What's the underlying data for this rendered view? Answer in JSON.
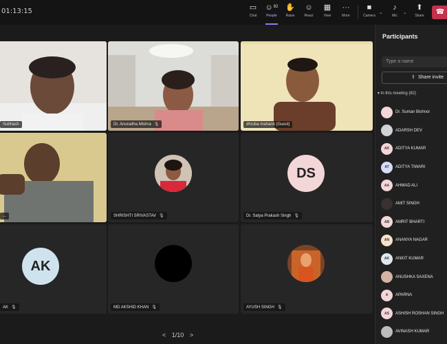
{
  "timer": "01:13:15",
  "toolbar": {
    "chat": {
      "label": "Chat",
      "icon": "chat-icon"
    },
    "people": {
      "label": "People",
      "count": "82",
      "icon": "people-icon"
    },
    "raise": {
      "label": "Raise",
      "icon": "hand-icon"
    },
    "react": {
      "label": "React",
      "icon": "react-icon"
    },
    "view": {
      "label": "View",
      "icon": "view-icon"
    },
    "more": {
      "label": "More",
      "icon": "more-icon"
    },
    "camera": {
      "label": "Camera",
      "icon": "camera-icon"
    },
    "mic": {
      "label": "Mic",
      "icon": "mic-icon"
    },
    "share": {
      "label": "Share",
      "icon": "share-icon"
    },
    "leave": {
      "icon": "phone-hangup-icon",
      "color": "#c4314b"
    }
  },
  "tiles": [
    {
      "name": "Subhash"
    },
    {
      "name": "Dr. Anuradha Mishra"
    },
    {
      "name": "dhruba mahanti (Guest)"
    },
    {
      "name": "..."
    },
    {
      "name": "SHRISHTI SRIVASTAV"
    },
    {
      "name": "Dr. Satya Prakash Singh",
      "initials": "DS"
    },
    {
      "name": "AK",
      "initials": "AK"
    },
    {
      "name": "MD AKSHID KHAN"
    },
    {
      "name": "AYUSH SINGH"
    }
  ],
  "pager": {
    "prev": "<",
    "text": "1/10",
    "next": ">"
  },
  "panel": {
    "title": "Participants",
    "search_placeholder": "Type a name",
    "share_invite": "Share invite",
    "section": "In this meeting (82)",
    "participants": [
      {
        "initials": "",
        "name": "Dr. Suman Bishnoi"
      },
      {
        "initials": "",
        "name": "ADARSH DEV"
      },
      {
        "initials": "AK",
        "name": "ADITYA KUMAR"
      },
      {
        "initials": "AT",
        "name": "ADITYA TIWARI"
      },
      {
        "initials": "AA",
        "name": "AHMAD ALI"
      },
      {
        "initials": "",
        "name": "AMIT SINGH"
      },
      {
        "initials": "AB",
        "name": "AMRIT BHARTI"
      },
      {
        "initials": "AN",
        "name": "ANANYA NAGAR"
      },
      {
        "initials": "AK",
        "name": "ANKIT KUMAR"
      },
      {
        "initials": "",
        "name": "ANUSHKA SAXENA"
      },
      {
        "initials": "A",
        "name": "APARNA"
      },
      {
        "initials": "AS",
        "name": "ASHISH ROSHAN SINGH"
      },
      {
        "initials": "",
        "name": "AVINASH KUMAR"
      }
    ]
  },
  "colors": {
    "accent": "#7f85f5",
    "avatar_fill": "#f3d6d8",
    "ak_fill": "#cfe3ee",
    "leave": "#c4314b"
  }
}
